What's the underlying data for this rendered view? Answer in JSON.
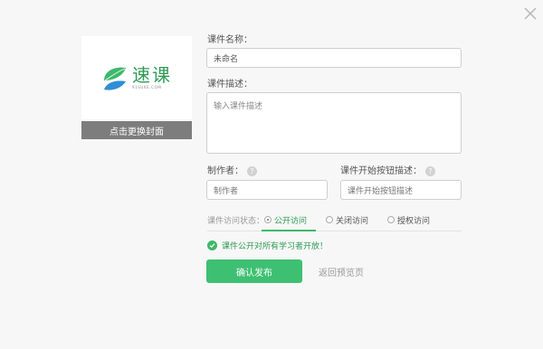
{
  "cover": {
    "logo_cn": "速课",
    "logo_url": "91SUKE.COM",
    "change_cover_label": "点击更换封面"
  },
  "form": {
    "name_label": "课件名称：",
    "name_value": "未命名",
    "desc_label": "课件描述：",
    "desc_placeholder": "输入课件描述",
    "author_label": "制作者：",
    "author_placeholder": "制作者",
    "button_desc_label": "课件开始按钮描述：",
    "button_desc_placeholder": "课件开始按钮描述",
    "help_glyph": "?"
  },
  "access": {
    "label": "课件访问状态：",
    "options": [
      {
        "label": "公开访问",
        "selected": true
      },
      {
        "label": "关闭访问",
        "selected": false
      },
      {
        "label": "授权访问",
        "selected": false
      }
    ],
    "status_message": "课件公开对所有学习者开放！"
  },
  "actions": {
    "confirm_label": "确认发布",
    "back_label": "返回预览页"
  },
  "colors": {
    "accent": "#3ec072",
    "accent_text": "#2e9a55",
    "cover_button": "#7d7d7d",
    "background": "#f7f7f7"
  }
}
